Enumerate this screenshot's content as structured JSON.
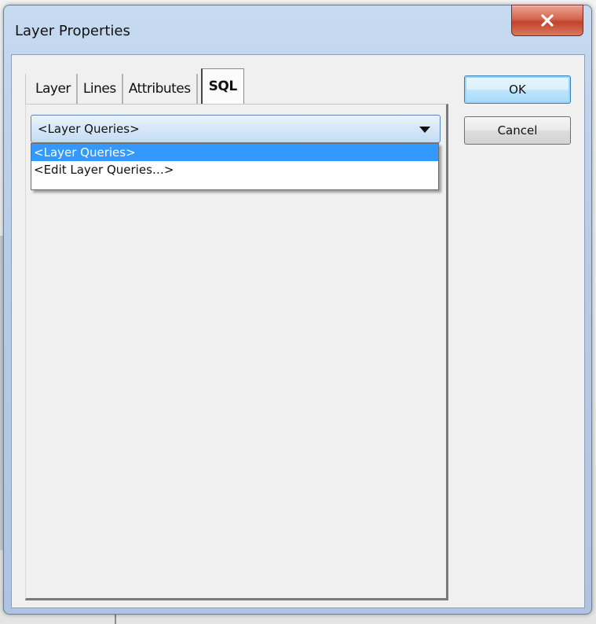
{
  "window": {
    "title": "Layer Properties"
  },
  "tabs": [
    {
      "label": "Layer"
    },
    {
      "label": "Lines"
    },
    {
      "label": "Attributes"
    },
    {
      "label": "SQL"
    }
  ],
  "active_tab": "SQL",
  "combo": {
    "value": "<Layer Queries>",
    "options": [
      "<Layer Queries>",
      "<Edit Layer Queries…>"
    ],
    "highlighted_option": "<Layer Queries>"
  },
  "buttons": {
    "ok": "OK",
    "cancel": "Cancel"
  },
  "icons": {
    "close": "close-icon",
    "dropdown": "chevron-down-icon"
  },
  "colors": {
    "selection": "#3399ff",
    "close_button": "#c2432b"
  }
}
